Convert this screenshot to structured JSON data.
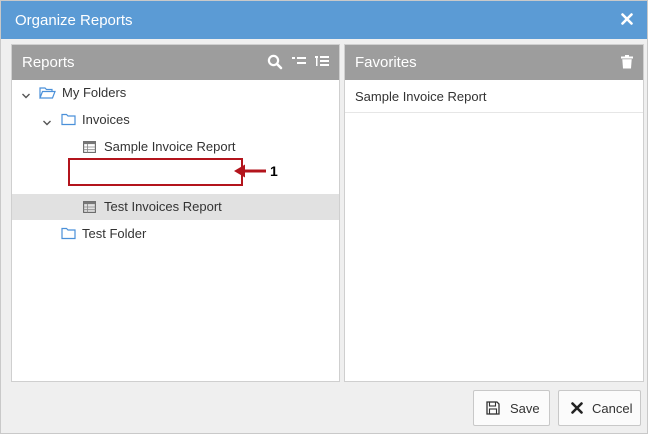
{
  "dialog": {
    "title": "Organize Reports"
  },
  "reports_panel": {
    "title": "Reports",
    "tree": {
      "root": "My Folders",
      "folder": "Invoices",
      "items": [
        "Sample Invoice Report",
        "Test Invoices Report"
      ],
      "other_folder": "Test Folder"
    }
  },
  "favorites_panel": {
    "title": "Favorites",
    "items": [
      "Sample Invoice Report"
    ]
  },
  "footer": {
    "save_label": "Save",
    "cancel_label": "Cancel"
  },
  "annotation": {
    "callout_number": "1",
    "color": "#b3141c"
  },
  "colors": {
    "titlebar": "#5b9bd5",
    "panel_header": "#9d9d9d",
    "selected_row": "#e1e1e1",
    "icon_blue": "#4a90d9"
  }
}
